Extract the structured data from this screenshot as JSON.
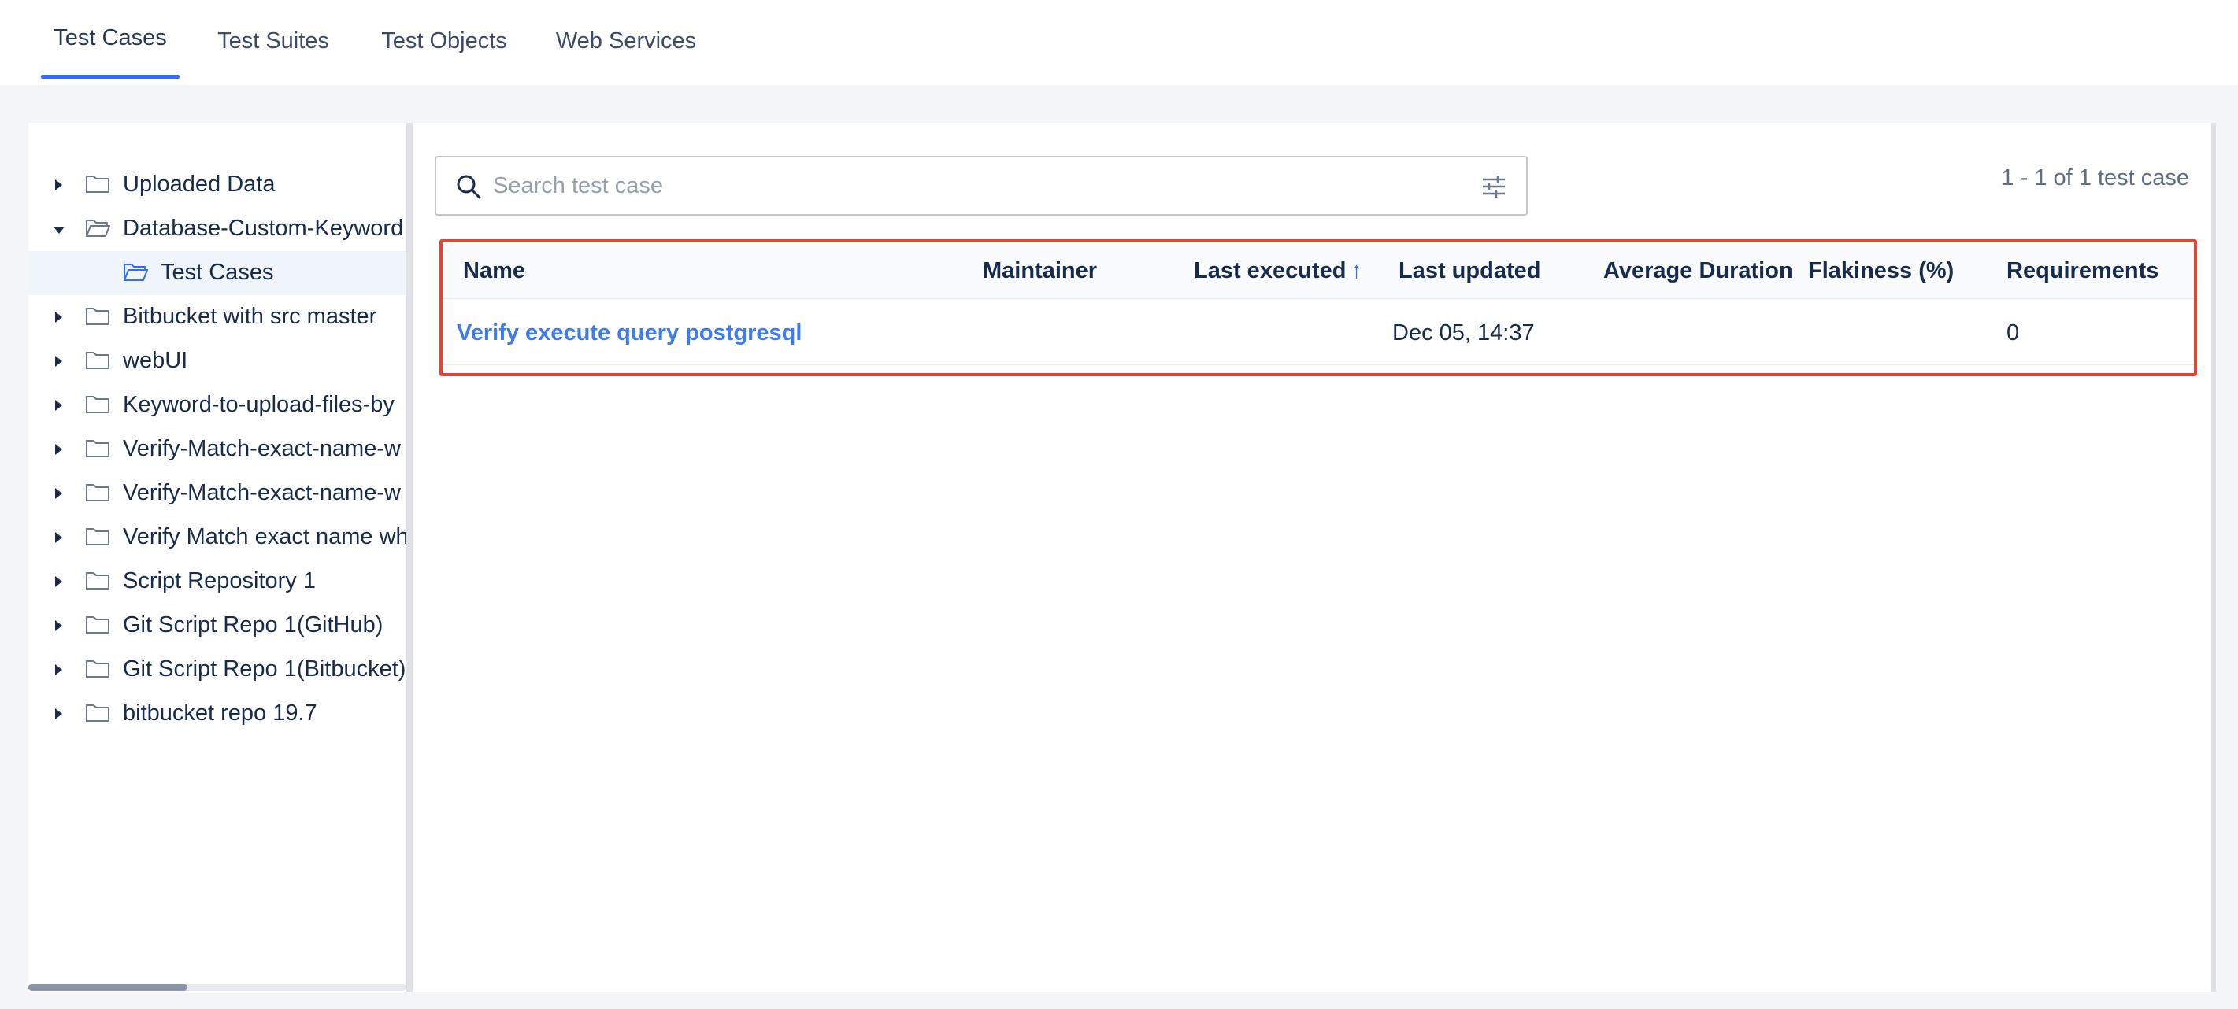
{
  "tabs": [
    {
      "label": "Test Cases",
      "active": true
    },
    {
      "label": "Test Suites",
      "active": false
    },
    {
      "label": "Test Objects",
      "active": false
    },
    {
      "label": "Web Services",
      "active": false
    }
  ],
  "tree": {
    "items": [
      {
        "label": "Uploaded Data",
        "expanded": false,
        "icon": "folder-icon"
      },
      {
        "label": "Database-Custom-Keyword",
        "expanded": true,
        "icon": "folder-open-icon"
      },
      {
        "label": "Test Cases",
        "expanded": false,
        "icon": "folder-open-icon",
        "selected": true
      },
      {
        "label": "Bitbucket with src master",
        "expanded": false,
        "icon": "folder-icon"
      },
      {
        "label": "webUI",
        "expanded": false,
        "icon": "folder-icon"
      },
      {
        "label": "Keyword-to-upload-files-by",
        "expanded": false,
        "icon": "folder-icon"
      },
      {
        "label": "Verify-Match-exact-name-w",
        "expanded": false,
        "icon": "folder-icon"
      },
      {
        "label": "Verify-Match-exact-name-w",
        "expanded": false,
        "icon": "folder-icon"
      },
      {
        "label": "Verify Match exact name wh",
        "expanded": false,
        "icon": "folder-icon"
      },
      {
        "label": "Script Repository 1",
        "expanded": false,
        "icon": "folder-icon"
      },
      {
        "label": "Git Script Repo 1(GitHub)",
        "expanded": false,
        "icon": "folder-icon"
      },
      {
        "label": "Git Script Repo 1(Bitbucket)",
        "expanded": false,
        "icon": "folder-icon"
      },
      {
        "label": "bitbucket repo 19.7",
        "expanded": false,
        "icon": "folder-icon"
      }
    ]
  },
  "search": {
    "placeholder": "Search test case",
    "value": ""
  },
  "result_count": "1 - 1 of 1 test case",
  "table": {
    "columns": [
      "Name",
      "Maintainer",
      "Last executed",
      "Last updated",
      "Average Duration",
      "Flakiness (%)",
      "Requirements"
    ],
    "sorted_column": "Last executed",
    "sort_indicator": "↑",
    "rows": [
      {
        "name": "Verify execute query postgresql",
        "maintainer": "",
        "last_executed": "",
        "last_updated": "Dec 05, 14:37",
        "average_duration": "",
        "flakiness": "",
        "requirements": "0"
      }
    ]
  },
  "colors": {
    "accent": "#2f6ef5",
    "link": "#3d7bf0",
    "highlight_border": "#e2442f",
    "text": "#172b4d"
  }
}
